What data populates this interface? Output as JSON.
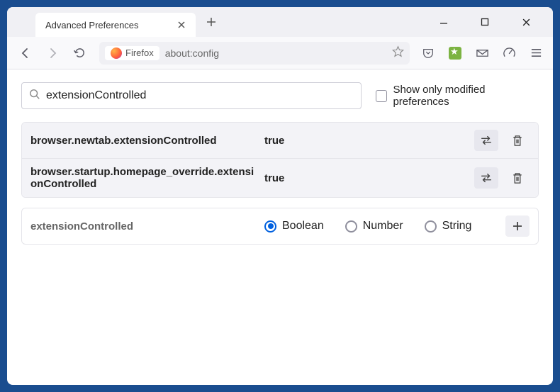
{
  "tab": {
    "title": "Advanced Preferences"
  },
  "toolbar": {
    "firefox_chip": "Firefox",
    "url": "about:config"
  },
  "search": {
    "value": "extensionControlled",
    "modified_only_label": "Show only modified preferences",
    "modified_only_checked": false
  },
  "prefs": [
    {
      "name": "browser.newtab.extensionControlled",
      "value": "true"
    },
    {
      "name": "browser.startup.homepage_override.extensionControlled",
      "value": "true"
    }
  ],
  "newpref": {
    "name": "extensionControlled",
    "types": [
      {
        "label": "Boolean",
        "selected": true
      },
      {
        "label": "Number",
        "selected": false
      },
      {
        "label": "String",
        "selected": false
      }
    ]
  }
}
